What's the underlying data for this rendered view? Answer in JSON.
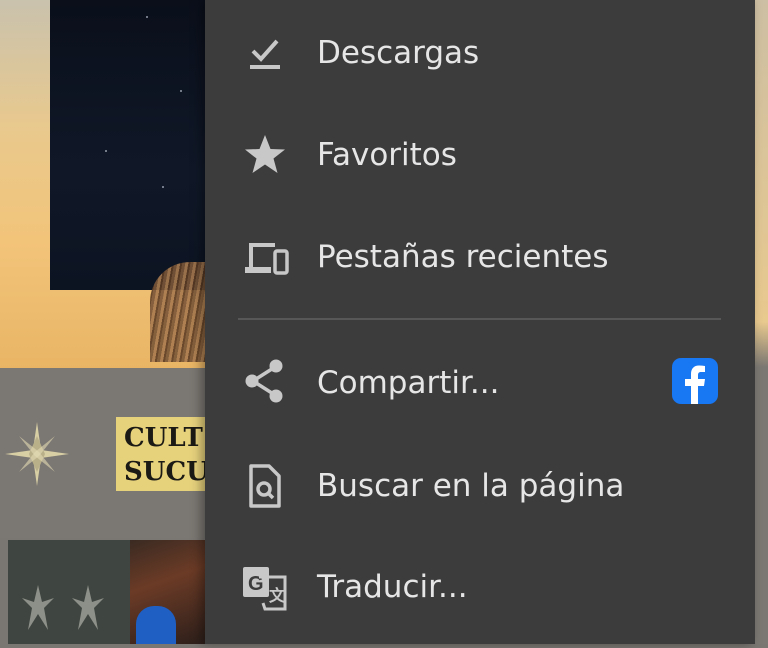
{
  "menu": {
    "items": [
      {
        "label": "Descargas",
        "icon": "download-done-icon"
      },
      {
        "label": "Favoritos",
        "icon": "star-icon"
      },
      {
        "label": "Pestañas recientes",
        "icon": "devices-icon"
      },
      {
        "label": "Compartir...",
        "icon": "share-icon",
        "badge_icon": "facebook-icon"
      },
      {
        "label": "Buscar en la página",
        "icon": "find-in-page-icon"
      },
      {
        "label": "Traducir...",
        "icon": "translate-icon"
      }
    ]
  },
  "background": {
    "tag_text": "CULT\nSUCU"
  },
  "colors": {
    "menu_bg": "#3c3c3d",
    "menu_text": "#e6e6e6",
    "icon": "#c8c8c8",
    "facebook": "#1877f2"
  }
}
